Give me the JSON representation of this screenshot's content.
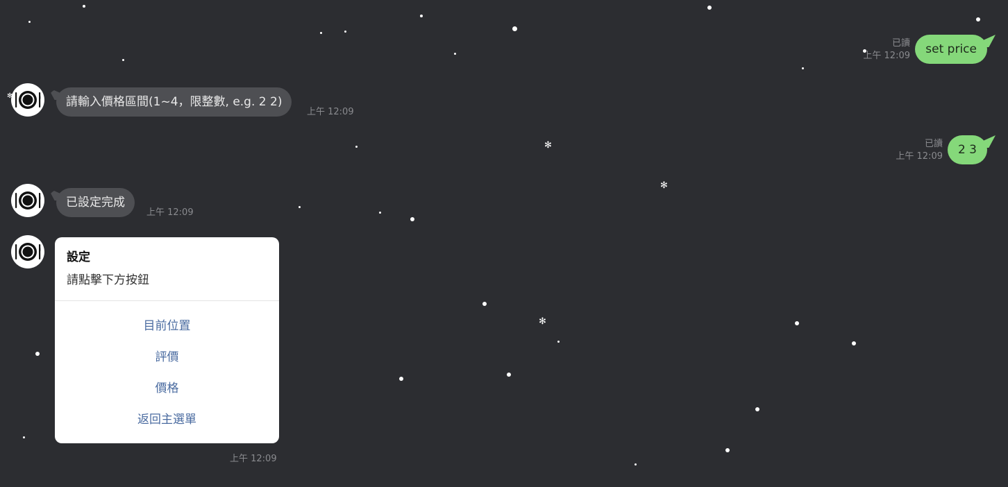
{
  "messages": {
    "out1": {
      "text": "set price",
      "read": "已讀",
      "time": "上午 12:09"
    },
    "in1": {
      "text": "請輸入價格區間(1~4，限整數, e.g. 2 2)",
      "time": "上午 12:09"
    },
    "out2": {
      "text": "2 3",
      "read": "已讀",
      "time": "上午 12:09"
    },
    "in2": {
      "text": "已設定完成",
      "time": "上午 12:09"
    }
  },
  "card": {
    "title": "設定",
    "subtitle": "請點擊下方按鈕",
    "actions": [
      "目前位置",
      "評價",
      "價格",
      "返回主選單"
    ],
    "time": "上午 12:09"
  },
  "colors": {
    "background": "#2c2d31",
    "incoming_bubble": "#4e4f53",
    "outgoing_bubble": "#85d87a",
    "action_link": "#4a6ba0"
  },
  "icons": {
    "avatar": "plate-fork-knife-icon",
    "snowflake": "snowflake-icon"
  }
}
